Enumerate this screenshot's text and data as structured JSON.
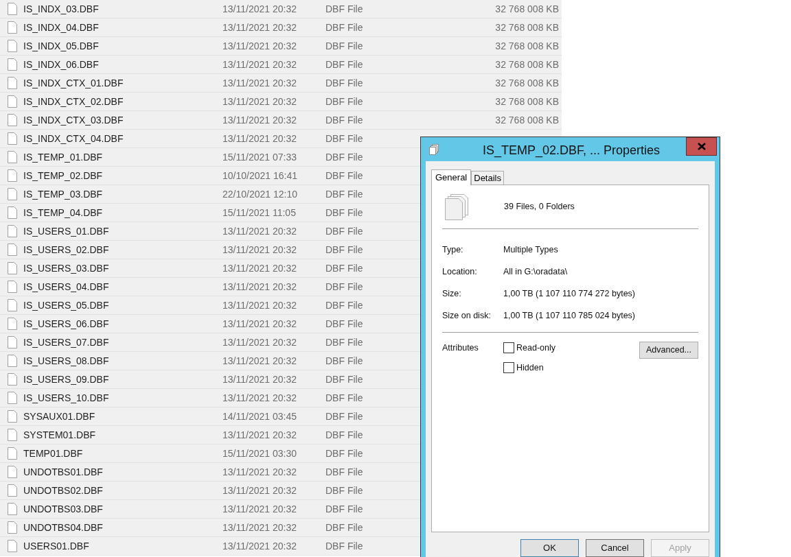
{
  "files": [
    {
      "name": "IS_INDX_03.DBF",
      "date": "13/11/2021 20:32",
      "type": "DBF File",
      "size": "32 768 008 KB"
    },
    {
      "name": "IS_INDX_04.DBF",
      "date": "13/11/2021 20:32",
      "type": "DBF File",
      "size": "32 768 008 KB"
    },
    {
      "name": "IS_INDX_05.DBF",
      "date": "13/11/2021 20:32",
      "type": "DBF File",
      "size": "32 768 008 KB"
    },
    {
      "name": "IS_INDX_06.DBF",
      "date": "13/11/2021 20:32",
      "type": "DBF File",
      "size": "32 768 008 KB"
    },
    {
      "name": "IS_INDX_CTX_01.DBF",
      "date": "13/11/2021 20:32",
      "type": "DBF File",
      "size": "32 768 008 KB"
    },
    {
      "name": "IS_INDX_CTX_02.DBF",
      "date": "13/11/2021 20:32",
      "type": "DBF File",
      "size": "32 768 008 KB"
    },
    {
      "name": "IS_INDX_CTX_03.DBF",
      "date": "13/11/2021 20:32",
      "type": "DBF File",
      "size": "32 768 008 KB"
    },
    {
      "name": "IS_INDX_CTX_04.DBF",
      "date": "13/11/2021 20:32",
      "type": "DBF File"
    },
    {
      "name": "IS_TEMP_01.DBF",
      "date": "15/11/2021 07:33",
      "type": "DBF File"
    },
    {
      "name": "IS_TEMP_02.DBF",
      "date": "10/10/2021 16:41",
      "type": "DBF File"
    },
    {
      "name": "IS_TEMP_03.DBF",
      "date": "22/10/2021 12:10",
      "type": "DBF File"
    },
    {
      "name": "IS_TEMP_04.DBF",
      "date": "15/11/2021 11:05",
      "type": "DBF File"
    },
    {
      "name": "IS_USERS_01.DBF",
      "date": "13/11/2021 20:32",
      "type": "DBF File"
    },
    {
      "name": "IS_USERS_02.DBF",
      "date": "13/11/2021 20:32",
      "type": "DBF File"
    },
    {
      "name": "IS_USERS_03.DBF",
      "date": "13/11/2021 20:32",
      "type": "DBF File"
    },
    {
      "name": "IS_USERS_04.DBF",
      "date": "13/11/2021 20:32",
      "type": "DBF File"
    },
    {
      "name": "IS_USERS_05.DBF",
      "date": "13/11/2021 20:32",
      "type": "DBF File"
    },
    {
      "name": "IS_USERS_06.DBF",
      "date": "13/11/2021 20:32",
      "type": "DBF File"
    },
    {
      "name": "IS_USERS_07.DBF",
      "date": "13/11/2021 20:32",
      "type": "DBF File"
    },
    {
      "name": "IS_USERS_08.DBF",
      "date": "13/11/2021 20:32",
      "type": "DBF File"
    },
    {
      "name": "IS_USERS_09.DBF",
      "date": "13/11/2021 20:32",
      "type": "DBF File"
    },
    {
      "name": "IS_USERS_10.DBF",
      "date": "13/11/2021 20:32",
      "type": "DBF File"
    },
    {
      "name": "SYSAUX01.DBF",
      "date": "14/11/2021 03:45",
      "type": "DBF File"
    },
    {
      "name": "SYSTEM01.DBF",
      "date": "13/11/2021 20:32",
      "type": "DBF File"
    },
    {
      "name": "TEMP01.DBF",
      "date": "15/11/2021 03:30",
      "type": "DBF File"
    },
    {
      "name": "UNDOTBS01.DBF",
      "date": "13/11/2021 20:32",
      "type": "DBF File"
    },
    {
      "name": "UNDOTBS02.DBF",
      "date": "13/11/2021 20:32",
      "type": "DBF File"
    },
    {
      "name": "UNDOTBS03.DBF",
      "date": "13/11/2021 20:32",
      "type": "DBF File"
    },
    {
      "name": "UNDOTBS04.DBF",
      "date": "13/11/2021 20:32",
      "type": "DBF File"
    },
    {
      "name": "USERS01.DBF",
      "date": "13/11/2021 20:32",
      "type": "DBF File"
    }
  ],
  "dialog": {
    "title": "IS_TEMP_02.DBF, ... Properties",
    "tabs": [
      {
        "label": "General",
        "selected": true
      },
      {
        "label": "Details",
        "selected": false
      }
    ],
    "summary": "39 Files, 0 Folders",
    "info": [
      {
        "label": "Type:",
        "value": "Multiple Types"
      },
      {
        "label": "Location:",
        "value": "All in G:\\oradata\\"
      }
    ],
    "sizes": [
      {
        "label": "Size:",
        "value": "1,00 TB (1 107 110 774 272 bytes)"
      },
      {
        "label": "Size on disk:",
        "value": "1,00 TB (1 107 110 785 024 bytes)"
      }
    ],
    "attributes_label": "Attributes",
    "attributes": [
      {
        "label": "Read-only",
        "checked": false
      },
      {
        "label": "Hidden",
        "checked": false
      }
    ],
    "advanced": "Advanced...",
    "buttons": [
      {
        "label": "OK",
        "default": true,
        "disabled": false
      },
      {
        "label": "Cancel",
        "default": false,
        "disabled": false
      },
      {
        "label": "Apply",
        "default": false,
        "disabled": true
      }
    ]
  }
}
